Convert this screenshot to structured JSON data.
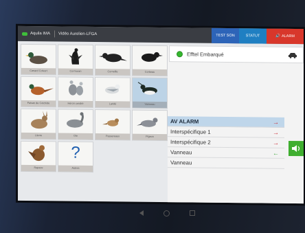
{
  "topbar": {
    "app_name": "Aquila IMA",
    "user": "Vidéo Aurelien-LFGA",
    "buttons": [
      "TEST SON",
      "STATUT",
      "ALARM"
    ]
  },
  "species": [
    {
      "label": "Canard Colvert"
    },
    {
      "label": "Cormoran"
    },
    {
      "label": "Corneille"
    },
    {
      "label": "Corbeau"
    },
    {
      "label": "Faisan de Colchide"
    },
    {
      "label": "Héron cendré"
    },
    {
      "label": "Laridé"
    },
    {
      "label": "Vanneau"
    },
    {
      "label": "Lièvre"
    },
    {
      "label": "Oie"
    },
    {
      "label": "Passereaux"
    },
    {
      "label": "Pigeon"
    },
    {
      "label": "Rapace"
    },
    {
      "label": "Autres"
    }
  ],
  "status_panel": {
    "label": "Efftel Embarqué",
    "vehicle_icon": "car-icon"
  },
  "sound_list": {
    "header": "AV ALARM",
    "rows": [
      {
        "label": "Interspécifique 1",
        "arrow": "right-arrow-red"
      },
      {
        "label": "Interspécifique 2",
        "arrow": "right-arrow-red"
      },
      {
        "label": "Vanneau",
        "arrow": "left-arrow-green"
      },
      {
        "label": "Vanneau",
        "arrow": ""
      }
    ],
    "header_arrow": "right-arrow-red"
  },
  "colors": {
    "accent_blue": "#2d64b8",
    "alarm_red": "#d8372b",
    "ok_green": "#3fae2f",
    "selected": "#bcd3e6"
  }
}
